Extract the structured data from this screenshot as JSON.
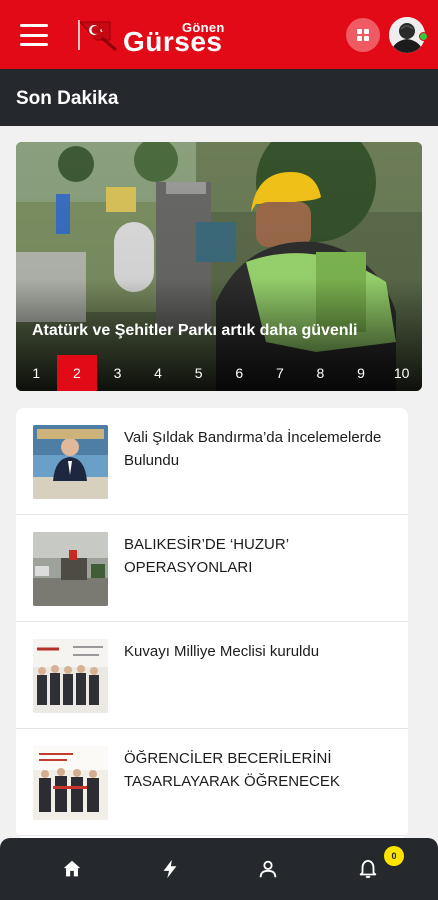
{
  "header": {
    "brand_small": "Gönen",
    "brand_big": "Gürses",
    "menu_icon": "hamburger-menu-icon",
    "apps_icon": "grid-apps-icon",
    "avatar_icon": "user-avatar",
    "online_status_color": "#2ecc40",
    "brand_color": "#e30a17"
  },
  "section": {
    "title": "Son Dakika"
  },
  "slider": {
    "headline": "Atatürk ve Şehitler Parkı artık daha güvenli",
    "pages": [
      "1",
      "2",
      "3",
      "4",
      "5",
      "6",
      "7",
      "8",
      "9",
      "10"
    ],
    "active_page": "2"
  },
  "news": [
    {
      "headline": "Vali Şıldak Bandırma’da İncelemelerde Bulundu"
    },
    {
      "headline": "BALIKESİR’DE ‘HUZUR’ OPERASYONLARI"
    },
    {
      "headline": "Kuvayı Milliye Meclisi kuruldu"
    },
    {
      "headline": "ÖĞRENCİLER BECERİLERİNİ TASARLAYARAK ÖĞRENECEK"
    }
  ],
  "bottom_nav": {
    "items": [
      "home-icon",
      "flash-icon",
      "user-icon",
      "bell-icon"
    ],
    "notification_badge": "0",
    "badge_color": "#ffe400"
  }
}
